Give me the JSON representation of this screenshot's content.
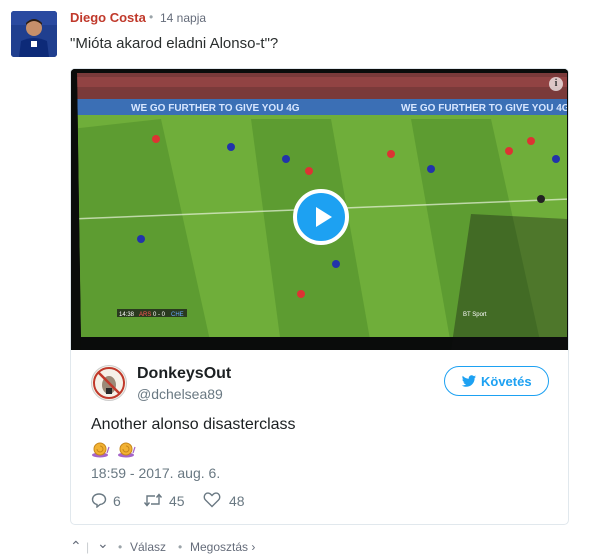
{
  "comment": {
    "author": "Diego Costa",
    "separator": "•",
    "time": "14 napja",
    "text": "\"Mióta akarod eladni Alonso-t\"?"
  },
  "embed": {
    "video": {
      "banner_text": "WE GO FURTHER TO GIVE YOU 4G",
      "score_time": "14:38",
      "score_home": "ARS",
      "score": "0 - 0",
      "score_away": "CHE",
      "channel": "BT Sport",
      "info": "i"
    },
    "tweet": {
      "name": "DonkeysOut",
      "handle": "@dchelsea89",
      "follow_label": "Követés",
      "text": "Another alonso disasterclass",
      "date": "18:59 - 2017. aug. 6.",
      "replies": "6",
      "retweets": "45",
      "likes": "48"
    }
  },
  "footer": {
    "upvote": "⌃",
    "divider": "|",
    "downvote": "⌄",
    "bullet1": "•",
    "reply_label": "Válasz",
    "bullet2": "•",
    "share_label": "Megosztás ›"
  },
  "colors": {
    "author": "#c0392b",
    "twitter_blue": "#1da1f2",
    "grass_light": "#6fae3a",
    "grass_dark": "#5a9930"
  },
  "icons": [
    "play-icon",
    "twitter-bird-icon",
    "reply-icon",
    "retweet-icon",
    "like-icon",
    "snail-icon",
    "info-icon"
  ]
}
